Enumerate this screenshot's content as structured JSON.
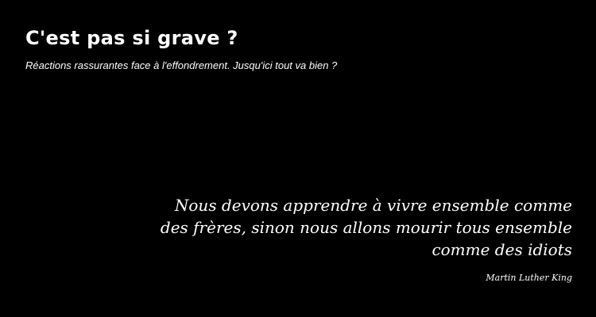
{
  "header": {
    "title": "C'est pas si grave ?",
    "tagline": "Réactions rassurantes face à l'effondrement. Jusqu'ici tout va bien ?"
  },
  "quote": {
    "text": "Nous devons apprendre à vivre ensemble comme des frères, sinon nous allons mourir tous ensemble comme des idiots",
    "author": "Martin Luther King"
  },
  "colors": {
    "background": "#000000",
    "text": "#ffffff"
  }
}
